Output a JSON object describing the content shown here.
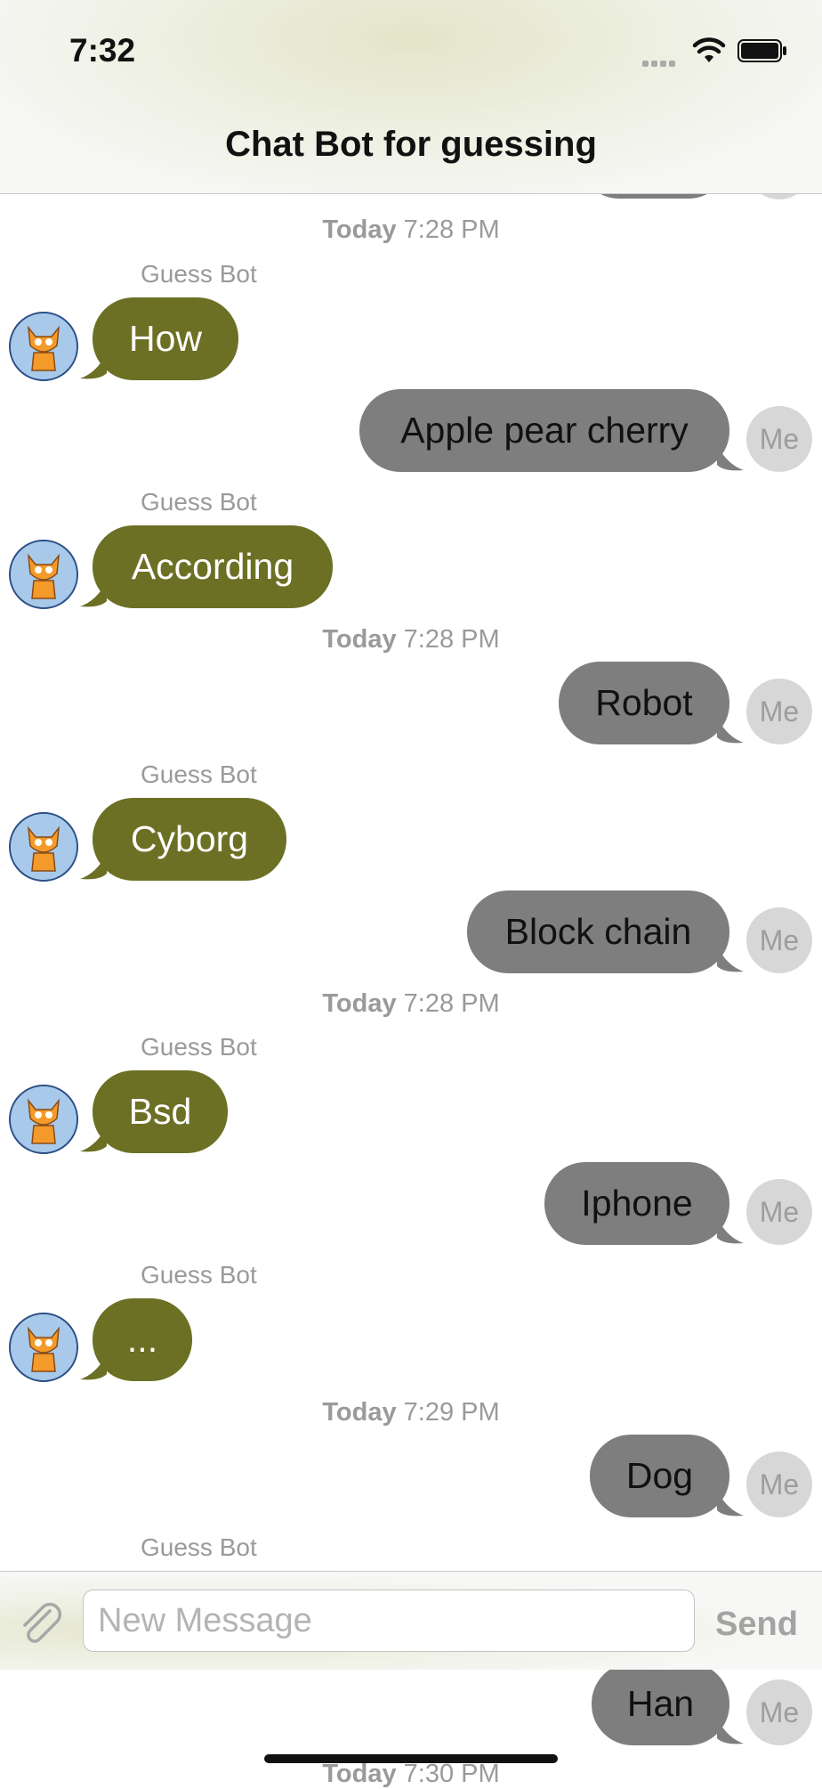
{
  "status_bar": {
    "time": "7:32"
  },
  "nav": {
    "title": "Chat Bot for guessing"
  },
  "chat": {
    "timestamps": [
      {
        "day": "Today",
        "time": "7:28 PM"
      },
      {
        "day": "Today",
        "time": "7:28 PM"
      },
      {
        "day": "Today",
        "time": "7:28 PM"
      },
      {
        "day": "Today",
        "time": "7:29 PM"
      },
      {
        "day": "Today",
        "time": "7:30 PM"
      }
    ],
    "bot_name": "Guess Bot",
    "me_avatar_label": "Me",
    "messages": [
      {
        "from": "bot",
        "text": "How"
      },
      {
        "from": "me",
        "text": "Apple pear cherry"
      },
      {
        "from": "bot",
        "text": "According"
      },
      {
        "from": "me",
        "text": "Robot"
      },
      {
        "from": "bot",
        "text": "Cyborg"
      },
      {
        "from": "me",
        "text": "Block chain"
      },
      {
        "from": "bot",
        "text": "Bsd"
      },
      {
        "from": "me",
        "text": "Iphone"
      },
      {
        "from": "bot",
        "text": "..."
      },
      {
        "from": "me",
        "text": "Dog"
      },
      {
        "from": "me",
        "text": "Han"
      }
    ]
  },
  "composer": {
    "placeholder": "New Message",
    "send_label": "Send"
  },
  "colors": {
    "bot_bubble": "#6b7024",
    "me_bubble": "#7d7e7d",
    "me_avatar": "#d7d7d7"
  }
}
